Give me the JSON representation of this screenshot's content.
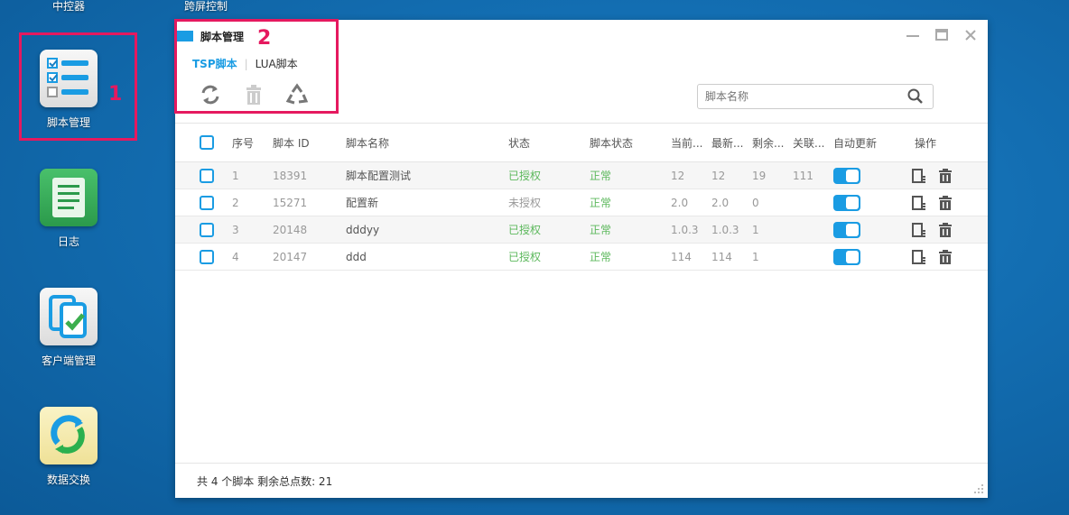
{
  "desktop": {
    "top_labels": [
      "中控器",
      "跨屏控制"
    ],
    "icons": [
      {
        "label": "脚本管理"
      },
      {
        "label": "日志"
      },
      {
        "label": "客户端管理"
      },
      {
        "label": "数据交换"
      }
    ],
    "annotations": [
      "1",
      "2"
    ]
  },
  "window": {
    "title": "脚本管理",
    "tabs": [
      {
        "label": "TSP脚本",
        "active": true
      },
      {
        "label": "LUA脚本",
        "active": false
      }
    ],
    "toolbar": [
      "refresh-icon",
      "trash-icon",
      "recycle-icon"
    ],
    "search": {
      "placeholder": "脚本名称",
      "value": ""
    },
    "table": {
      "headers": [
        "序号",
        "脚本 ID",
        "脚本名称",
        "状态",
        "脚本状态",
        "当前...",
        "最新...",
        "剩余...",
        "关联...",
        "自动更新",
        "操作"
      ],
      "rows": [
        [
          "1",
          "18391",
          "脚本配置测试",
          "已授权",
          "正常",
          "12",
          "12",
          "19",
          "111"
        ],
        [
          "2",
          "15271",
          "配置新",
          "未授权",
          "正常",
          "2.0",
          "2.0",
          "0",
          ""
        ],
        [
          "3",
          "20148",
          "dddyy",
          "已授权",
          "正常",
          "1.0.3",
          "1.0.3",
          "1",
          ""
        ],
        [
          "4",
          "20147",
          "ddd",
          "已授权",
          "正常",
          "114",
          "114",
          "1",
          ""
        ]
      ],
      "auto_update": [
        true,
        true,
        true,
        true
      ]
    },
    "footer": "共 4 个脚本 剩余总点数: 21"
  },
  "colors": {
    "accent": "#1a9ce3",
    "authorized": "#5cb85c",
    "annotation": "#e5195f"
  }
}
